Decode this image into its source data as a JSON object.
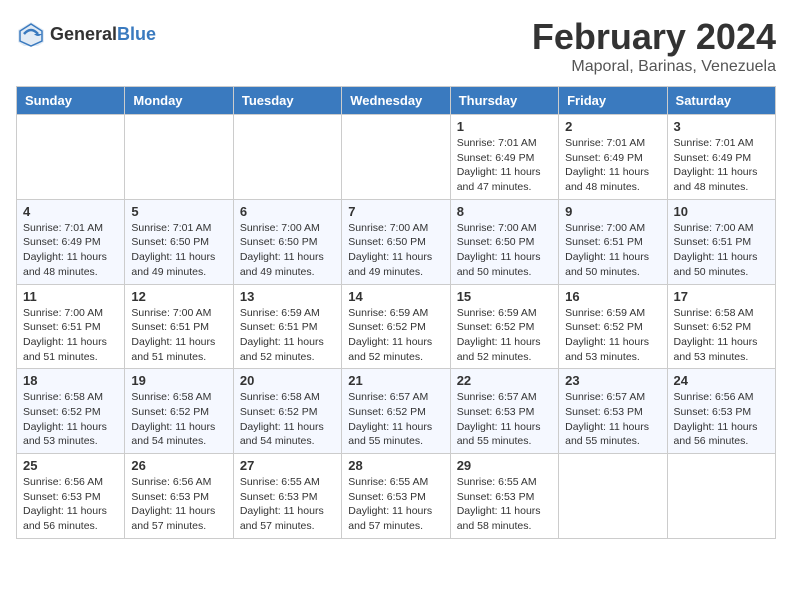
{
  "logo": {
    "general": "General",
    "blue": "Blue"
  },
  "title": "February 2024",
  "location": "Maporal, Barinas, Venezuela",
  "days_of_week": [
    "Sunday",
    "Monday",
    "Tuesday",
    "Wednesday",
    "Thursday",
    "Friday",
    "Saturday"
  ],
  "weeks": [
    [
      {
        "day": "",
        "info": ""
      },
      {
        "day": "",
        "info": ""
      },
      {
        "day": "",
        "info": ""
      },
      {
        "day": "",
        "info": ""
      },
      {
        "day": "1",
        "info": "Sunrise: 7:01 AM\nSunset: 6:49 PM\nDaylight: 11 hours and 47 minutes."
      },
      {
        "day": "2",
        "info": "Sunrise: 7:01 AM\nSunset: 6:49 PM\nDaylight: 11 hours and 48 minutes."
      },
      {
        "day": "3",
        "info": "Sunrise: 7:01 AM\nSunset: 6:49 PM\nDaylight: 11 hours and 48 minutes."
      }
    ],
    [
      {
        "day": "4",
        "info": "Sunrise: 7:01 AM\nSunset: 6:49 PM\nDaylight: 11 hours and 48 minutes."
      },
      {
        "day": "5",
        "info": "Sunrise: 7:01 AM\nSunset: 6:50 PM\nDaylight: 11 hours and 49 minutes."
      },
      {
        "day": "6",
        "info": "Sunrise: 7:00 AM\nSunset: 6:50 PM\nDaylight: 11 hours and 49 minutes."
      },
      {
        "day": "7",
        "info": "Sunrise: 7:00 AM\nSunset: 6:50 PM\nDaylight: 11 hours and 49 minutes."
      },
      {
        "day": "8",
        "info": "Sunrise: 7:00 AM\nSunset: 6:50 PM\nDaylight: 11 hours and 50 minutes."
      },
      {
        "day": "9",
        "info": "Sunrise: 7:00 AM\nSunset: 6:51 PM\nDaylight: 11 hours and 50 minutes."
      },
      {
        "day": "10",
        "info": "Sunrise: 7:00 AM\nSunset: 6:51 PM\nDaylight: 11 hours and 50 minutes."
      }
    ],
    [
      {
        "day": "11",
        "info": "Sunrise: 7:00 AM\nSunset: 6:51 PM\nDaylight: 11 hours and 51 minutes."
      },
      {
        "day": "12",
        "info": "Sunrise: 7:00 AM\nSunset: 6:51 PM\nDaylight: 11 hours and 51 minutes."
      },
      {
        "day": "13",
        "info": "Sunrise: 6:59 AM\nSunset: 6:51 PM\nDaylight: 11 hours and 52 minutes."
      },
      {
        "day": "14",
        "info": "Sunrise: 6:59 AM\nSunset: 6:52 PM\nDaylight: 11 hours and 52 minutes."
      },
      {
        "day": "15",
        "info": "Sunrise: 6:59 AM\nSunset: 6:52 PM\nDaylight: 11 hours and 52 minutes."
      },
      {
        "day": "16",
        "info": "Sunrise: 6:59 AM\nSunset: 6:52 PM\nDaylight: 11 hours and 53 minutes."
      },
      {
        "day": "17",
        "info": "Sunrise: 6:58 AM\nSunset: 6:52 PM\nDaylight: 11 hours and 53 minutes."
      }
    ],
    [
      {
        "day": "18",
        "info": "Sunrise: 6:58 AM\nSunset: 6:52 PM\nDaylight: 11 hours and 53 minutes."
      },
      {
        "day": "19",
        "info": "Sunrise: 6:58 AM\nSunset: 6:52 PM\nDaylight: 11 hours and 54 minutes."
      },
      {
        "day": "20",
        "info": "Sunrise: 6:58 AM\nSunset: 6:52 PM\nDaylight: 11 hours and 54 minutes."
      },
      {
        "day": "21",
        "info": "Sunrise: 6:57 AM\nSunset: 6:52 PM\nDaylight: 11 hours and 55 minutes."
      },
      {
        "day": "22",
        "info": "Sunrise: 6:57 AM\nSunset: 6:53 PM\nDaylight: 11 hours and 55 minutes."
      },
      {
        "day": "23",
        "info": "Sunrise: 6:57 AM\nSunset: 6:53 PM\nDaylight: 11 hours and 55 minutes."
      },
      {
        "day": "24",
        "info": "Sunrise: 6:56 AM\nSunset: 6:53 PM\nDaylight: 11 hours and 56 minutes."
      }
    ],
    [
      {
        "day": "25",
        "info": "Sunrise: 6:56 AM\nSunset: 6:53 PM\nDaylight: 11 hours and 56 minutes."
      },
      {
        "day": "26",
        "info": "Sunrise: 6:56 AM\nSunset: 6:53 PM\nDaylight: 11 hours and 57 minutes."
      },
      {
        "day": "27",
        "info": "Sunrise: 6:55 AM\nSunset: 6:53 PM\nDaylight: 11 hours and 57 minutes."
      },
      {
        "day": "28",
        "info": "Sunrise: 6:55 AM\nSunset: 6:53 PM\nDaylight: 11 hours and 57 minutes."
      },
      {
        "day": "29",
        "info": "Sunrise: 6:55 AM\nSunset: 6:53 PM\nDaylight: 11 hours and 58 minutes."
      },
      {
        "day": "",
        "info": ""
      },
      {
        "day": "",
        "info": ""
      }
    ]
  ]
}
